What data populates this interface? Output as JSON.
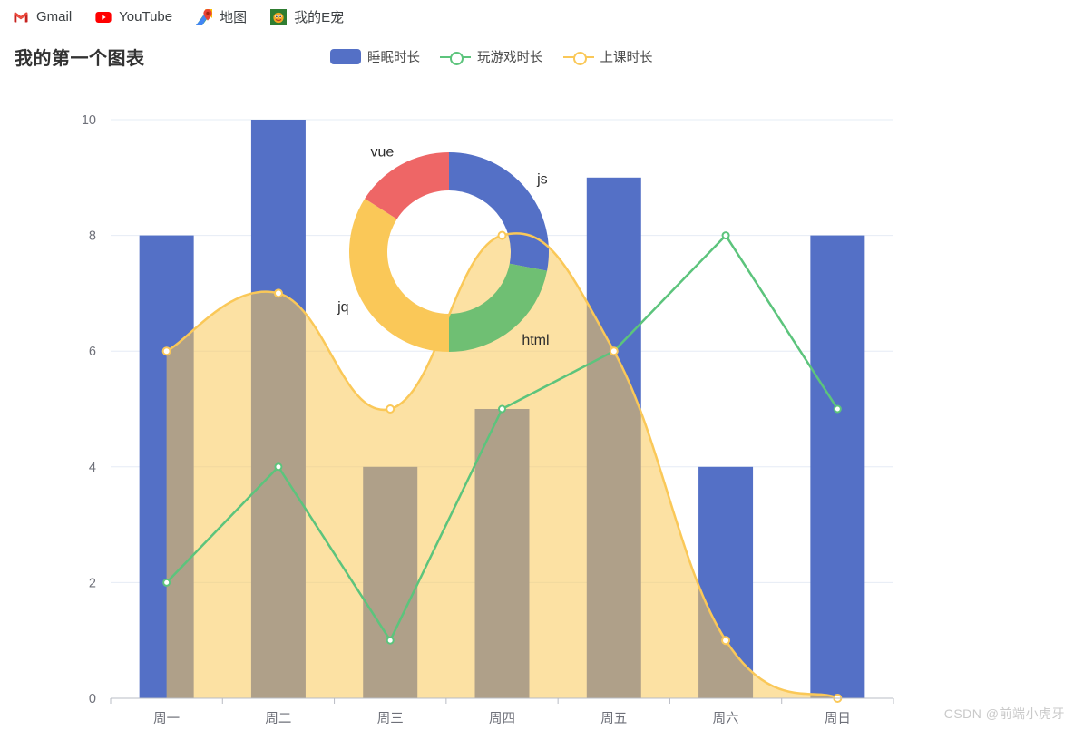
{
  "bookmarks": {
    "items": [
      {
        "label": "Gmail",
        "icon": "gmail-icon"
      },
      {
        "label": "YouTube",
        "icon": "youtube-icon"
      },
      {
        "label": "地图",
        "icon": "google-maps-icon"
      },
      {
        "label": "我的E宠",
        "icon": "my-epet-icon"
      }
    ]
  },
  "header": {
    "title": "我的第一个图表"
  },
  "legend": {
    "items": [
      {
        "label": "睡眠时长",
        "type": "bar",
        "color": "#5470C6"
      },
      {
        "label": "玩游戏时长",
        "type": "line",
        "color": "#5CC47C"
      },
      {
        "label": "上课时长",
        "type": "line",
        "color": "#FAC858"
      }
    ]
  },
  "watermark": {
    "text": "CSDN @前端小虎牙"
  },
  "chart_data": [
    {
      "type": "bar",
      "title": "我的第一个图表",
      "categories": [
        "周一",
        "周二",
        "周三",
        "周四",
        "周五",
        "周六",
        "周日"
      ],
      "xlabel": "",
      "ylabel": "",
      "ylim": [
        0,
        10
      ],
      "yticks": [
        0,
        2,
        4,
        6,
        8,
        10
      ],
      "grid": true,
      "legend_position": "top",
      "series": [
        {
          "name": "睡眠时长",
          "type": "bar",
          "color": "#5470C6",
          "values": [
            8,
            10,
            4,
            5,
            9,
            4,
            8
          ]
        },
        {
          "name": "玩游戏时长",
          "type": "line",
          "color": "#5CC47C",
          "values": [
            2,
            4,
            1,
            5,
            6,
            8,
            5
          ]
        },
        {
          "name": "上课时长",
          "type": "smooth-area",
          "color": "#FAC858",
          "values": [
            6,
            7,
            5,
            8,
            6,
            1,
            0
          ]
        }
      ]
    },
    {
      "type": "pie",
      "variant": "doughnut",
      "labels": [
        "js",
        "html",
        "jq",
        "vue"
      ],
      "values": [
        28,
        22,
        34,
        16
      ],
      "colors": [
        "#5470C6",
        "#6FBF73",
        "#FAC858",
        "#EE6666"
      ],
      "label_position": "outside",
      "center": [
        495,
        278
      ],
      "outer_radius": 110,
      "inner_radius": 68
    }
  ]
}
